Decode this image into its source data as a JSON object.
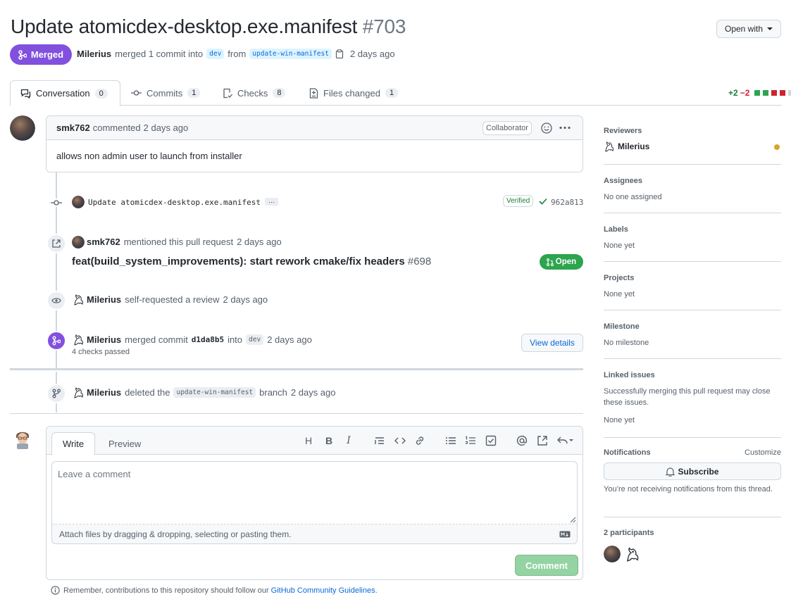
{
  "header": {
    "title": "Update atomicdex-desktop.exe.manifest",
    "number": "#703",
    "open_with": "Open with",
    "state": "Merged",
    "author": "Milerius",
    "merged_text": "merged 1 commit into",
    "base_branch": "dev",
    "from_text": "from",
    "head_branch": "update-win-manifest",
    "time": "2 days ago"
  },
  "tabs": [
    {
      "label": "Conversation",
      "count": "0"
    },
    {
      "label": "Commits",
      "count": "1"
    },
    {
      "label": "Checks",
      "count": "8"
    },
    {
      "label": "Files changed",
      "count": "1"
    }
  ],
  "diffstat": {
    "additions": "+2",
    "deletions": "−2"
  },
  "comment": {
    "author": "smk762",
    "action": "commented",
    "time": "2 days ago",
    "role": "Collaborator",
    "body": "allows non admin user to launch from installer"
  },
  "commit_event": {
    "message": "Update atomicdex-desktop.exe.manifest",
    "more": "…",
    "verified": "Verified",
    "sha": "962a813"
  },
  "mention_event": {
    "author": "smk762",
    "text": "mentioned this pull request",
    "time": "2 days ago",
    "pr_title": "feat(build_system_improvements): start rework cmake/fix headers",
    "pr_number": "#698",
    "pr_state": "Open"
  },
  "review_event": {
    "author": "Milerius",
    "text": "self-requested a review",
    "time": "2 days ago"
  },
  "merge_event": {
    "author": "Milerius",
    "text": "merged commit",
    "sha": "d1da8b5",
    "into": "into",
    "branch": "dev",
    "time": "2 days ago",
    "checks": "4 checks passed",
    "button": "View details"
  },
  "delete_event": {
    "author": "Milerius",
    "text": "deleted the",
    "branch": "update-win-manifest",
    "suffix": "branch",
    "time": "2 days ago"
  },
  "editor": {
    "tab_write": "Write",
    "tab_preview": "Preview",
    "placeholder": "Leave a comment",
    "attach": "Attach files by dragging & dropping, selecting or pasting them.",
    "submit": "Comment",
    "remember": "Remember, contributions to this repository should follow our",
    "guidelines_link": "GitHub Community Guidelines",
    "period": "."
  },
  "sidebar": {
    "reviewers": {
      "heading": "Reviewers",
      "name": "Milerius"
    },
    "assignees": {
      "heading": "Assignees",
      "value": "No one assigned"
    },
    "labels": {
      "heading": "Labels",
      "value": "None yet"
    },
    "projects": {
      "heading": "Projects",
      "value": "None yet"
    },
    "milestone": {
      "heading": "Milestone",
      "value": "No milestone"
    },
    "linked": {
      "heading": "Linked issues",
      "desc": "Successfully merging this pull request may close these issues.",
      "value": "None yet"
    },
    "notifications": {
      "heading": "Notifications",
      "customize": "Customize",
      "subscribe": "Subscribe",
      "desc": "You’re not receiving notifications from this thread."
    },
    "participants": {
      "heading": "2 participants"
    }
  },
  "colors": {
    "merged": "#8250df",
    "open": "#2da44e",
    "link": "#0969da",
    "pending": "#d4a72c"
  }
}
